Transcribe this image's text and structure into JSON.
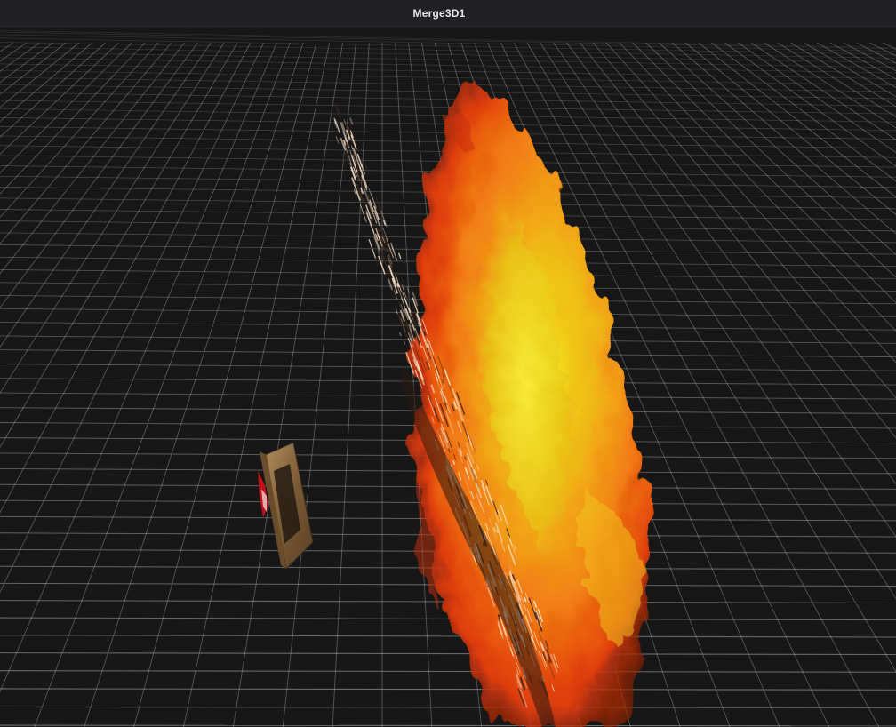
{
  "viewer": {
    "title": "Merge3D1"
  },
  "scene": {
    "background": "#171717",
    "grid_color": "#bfbfbf",
    "objects": [
      {
        "name": "fire-plane",
        "kind": "fire texture billboard"
      },
      {
        "name": "sparks-plane",
        "kind": "particle sparks"
      },
      {
        "name": "wooden-frame",
        "kind": "small textured frame"
      }
    ]
  },
  "colors": {
    "titlebar_bg": "#212125",
    "title_text": "#e8e8ea",
    "fire_outer": "#e2410c",
    "fire_mid": "#f57b12",
    "fire_core": "#e8d818",
    "spark": "#f6dcc0",
    "wood": "#8a6a42"
  }
}
